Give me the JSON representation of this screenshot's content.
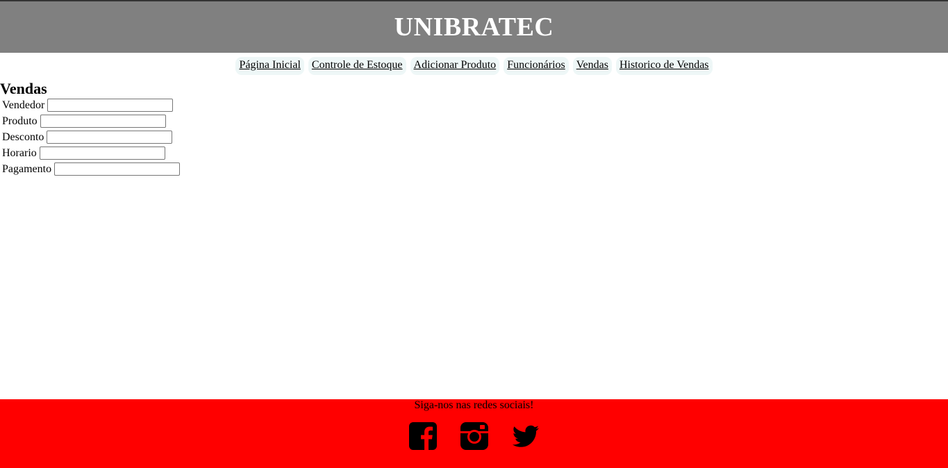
{
  "header": {
    "title": "UNIBRATEC"
  },
  "nav": {
    "items": [
      {
        "label": "Página Inicial"
      },
      {
        "label": "Controle de Estoque"
      },
      {
        "label": "Adicionar Produto"
      },
      {
        "label": "Funcionários"
      },
      {
        "label": "Vendas"
      },
      {
        "label": "Historico de Vendas"
      }
    ]
  },
  "main": {
    "title": "Vendas",
    "fields": [
      {
        "label": "Vendedor",
        "value": "",
        "placeholder": ""
      },
      {
        "label": "Produto",
        "value": "",
        "placeholder": ""
      },
      {
        "label": "Desconto",
        "value": "",
        "placeholder": ""
      },
      {
        "label": "Horario",
        "value": "",
        "placeholder": ""
      },
      {
        "label": "Pagamento",
        "value": "",
        "placeholder": ""
      }
    ]
  },
  "footer": {
    "text": "Siga-nos nas redes sociais!",
    "social": [
      {
        "icon": "facebook-icon"
      },
      {
        "icon": "instagram-icon"
      },
      {
        "icon": "twitter-icon"
      }
    ]
  },
  "colors": {
    "header_bg": "#808080",
    "header_text": "#ffffff",
    "nav_item_bg": "#eef7f7",
    "footer_bg": "#ff0000"
  }
}
